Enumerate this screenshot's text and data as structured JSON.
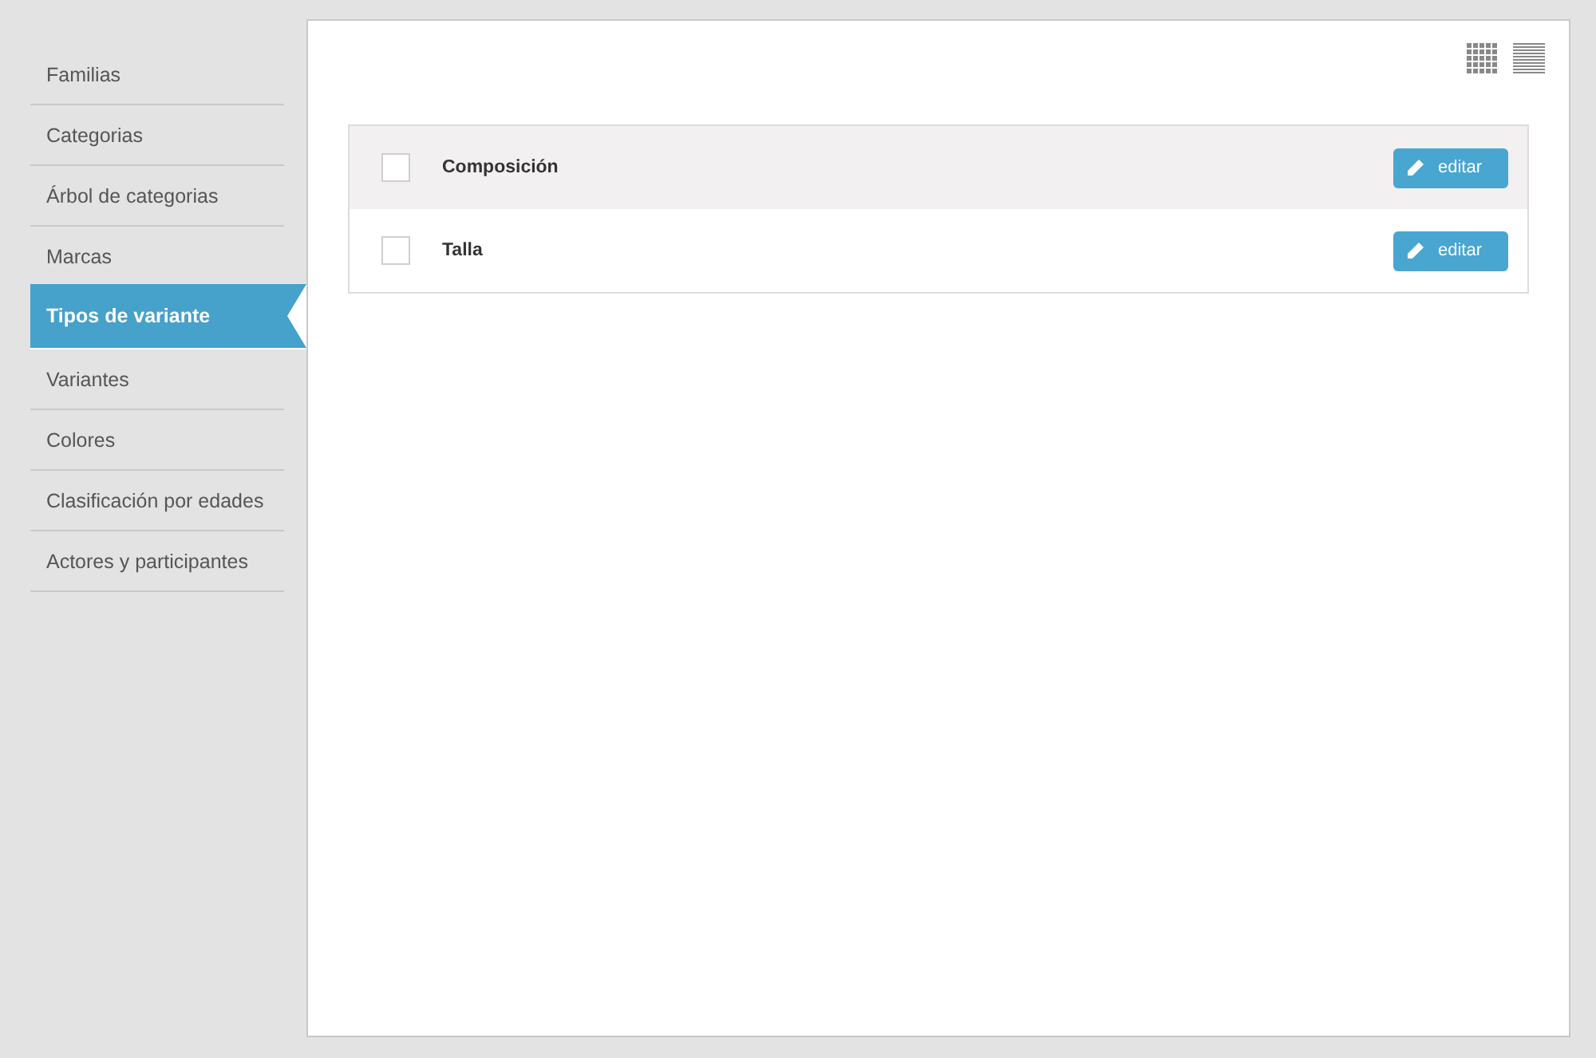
{
  "sidebar": {
    "items": [
      {
        "label": "Familias",
        "selected": false
      },
      {
        "label": "Categorias",
        "selected": false
      },
      {
        "label": "Árbol de categorias",
        "selected": false
      },
      {
        "label": "Marcas",
        "selected": false
      },
      {
        "label": "Tipos de variante",
        "selected": true
      },
      {
        "label": "Variantes",
        "selected": false
      },
      {
        "label": "Colores",
        "selected": false
      },
      {
        "label": "Clasificación por edades",
        "selected": false
      },
      {
        "label": "Actores y participantes",
        "selected": false
      }
    ]
  },
  "list": {
    "rows": [
      {
        "name": "Composición",
        "checked": false,
        "highlighted": true,
        "button": "editar"
      },
      {
        "name": "Talla",
        "checked": false,
        "highlighted": false,
        "button": "editar"
      }
    ]
  }
}
